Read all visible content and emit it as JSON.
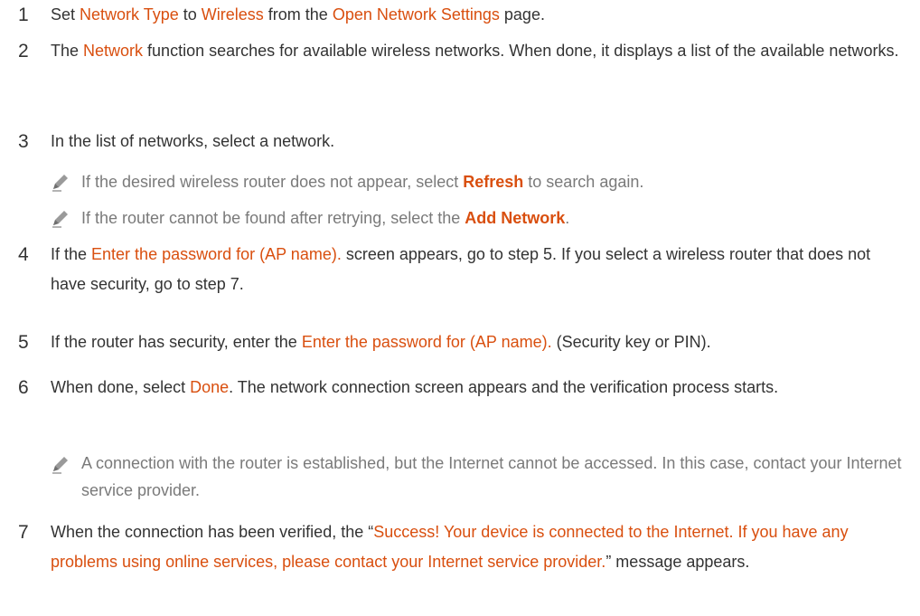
{
  "steps": {
    "s1": {
      "num": "1",
      "a": "Set ",
      "b": "Network Type",
      "c": " to ",
      "d": "Wireless",
      "e": " from the ",
      "f": "Open Network Settings",
      "g": " page."
    },
    "s2": {
      "num": "2",
      "a": "The ",
      "b": "Network",
      "c": " function searches for available wireless networks. When done, it displays a list of the available networks."
    },
    "s3": {
      "num": "3",
      "a": "In the list of networks, select a network."
    },
    "s4": {
      "num": "4",
      "a": "If the ",
      "b": "Enter the password for (AP name).",
      "c": " screen appears, go to step 5. If you select a wireless router that does not have security, go to step 7."
    },
    "s5": {
      "num": "5",
      "a": "If the router has security, enter the ",
      "b": "Enter the password for (AP name).",
      "c": " (Security key or PIN)."
    },
    "s6": {
      "num": "6",
      "a": "When done, select ",
      "b": "Done",
      "c": ". The network connection screen appears and the verification process starts."
    },
    "s7": {
      "num": "7",
      "a": "When the connection has been verified, the “",
      "b": "Success! Your device is connected to the Internet. If you have any problems using online services, please contact your Internet service provider.",
      "c": "” message appears."
    }
  },
  "notes": {
    "n1": {
      "a": "If the desired wireless router does not appear, select ",
      "b": "Refresh",
      "c": " to search again."
    },
    "n2": {
      "a": "If the router cannot be found after retrying, select the ",
      "b": "Add Network",
      "c": "."
    },
    "n3": {
      "a": "A connection with the router is established, but the Internet cannot be accessed. In this case, contact your Internet service provider."
    }
  },
  "icons": {
    "note": "pencil-icon"
  },
  "colors": {
    "highlight": "#d94f0f",
    "body_text": "#333333",
    "note_text": "#7a7a7a"
  }
}
